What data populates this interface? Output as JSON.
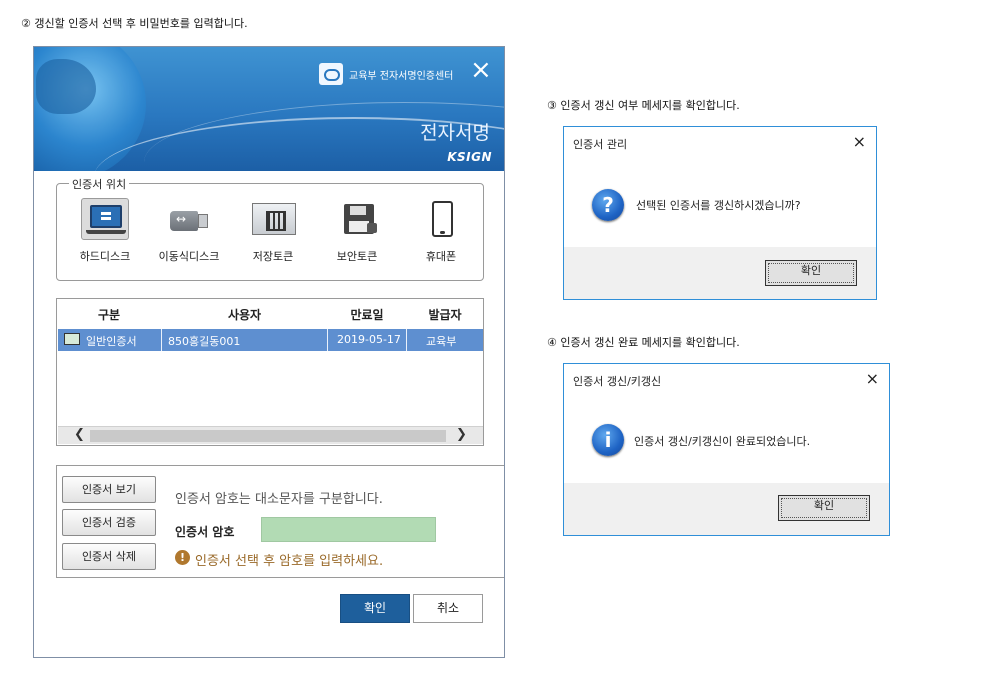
{
  "steps": {
    "step2": "② 갱신할 인증서 선택 후 비밀번호를 입력합니다.",
    "step3": "③ 인증서 갱신 여부 메세지를 확인합니다.",
    "step4": "④ 인증서 갱신 완료 메세지를 확인합니다."
  },
  "main_dialog": {
    "center_name": "교육부 전자서명인증센터",
    "close_icon": "×",
    "banner_title": "전자서명",
    "brand": "KSIGN",
    "location": {
      "legend": "인증서 위치",
      "items": [
        {
          "label": "하드디스크",
          "icon": "hard-disk-icon",
          "selected": true
        },
        {
          "label": "이동식디스크",
          "icon": "usb-drive-icon",
          "selected": false
        },
        {
          "label": "저장토큰",
          "icon": "storage-token-icon",
          "selected": false
        },
        {
          "label": "보안토큰",
          "icon": "security-token-icon",
          "selected": false
        },
        {
          "label": "휴대폰",
          "icon": "mobile-phone-icon",
          "selected": false
        }
      ]
    },
    "table": {
      "columns": [
        "구분",
        "사용자",
        "만료일",
        "발급자"
      ],
      "rows": [
        {
          "type": "일반인증서",
          "user": "850홍길동001",
          "expiry": "2019-05-17",
          "issuer": "교육부",
          "selected": true
        }
      ],
      "scroll_left": "❮",
      "scroll_right": "❯"
    },
    "buttons": {
      "view": "인증서 보기",
      "verify": "인증서 검증",
      "delete": "인증서 삭제"
    },
    "password": {
      "hint": "인증서 암호는 대소문자를 구분합니다.",
      "label": "인증서 암호",
      "value": "",
      "warning": "인증서 선택 후 암호를 입력하세요.",
      "warning_icon": "!"
    },
    "ok": "확인",
    "cancel": "취소"
  },
  "confirm_dialog": {
    "title": "인증서 관리",
    "close_icon": "×",
    "icon": "question-icon",
    "icon_glyph": "?",
    "message": "선택된 인증서를 갱신하시겠습니까?",
    "ok": "확인"
  },
  "done_dialog": {
    "title": "인증서 갱신/키갱신",
    "close_icon": "×",
    "icon": "info-icon",
    "icon_glyph": "i",
    "message": "인증서 갱신/키갱신이 완료되었습니다.",
    "ok": "확인"
  },
  "colors": {
    "banner": "#2a78c0",
    "selected_row": "#5e8fd0",
    "password_field": "#b2dbb4",
    "primary_button": "#1e5f9c",
    "warning": "#9a6a2a"
  }
}
